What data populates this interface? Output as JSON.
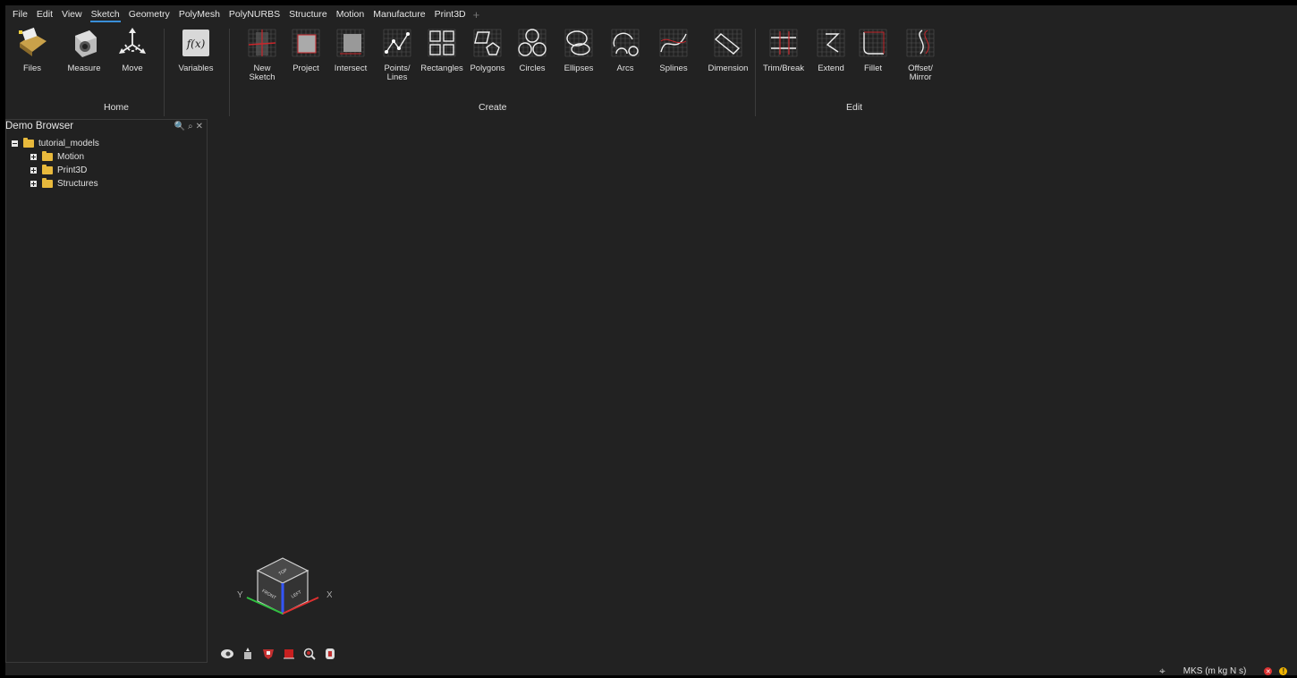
{
  "menu": [
    "File",
    "Edit",
    "View",
    "Sketch",
    "Geometry",
    "PolyMesh",
    "PolyNURBS",
    "Structure",
    "Motion",
    "Manufacture",
    "Print3D"
  ],
  "menu_active": "Sketch",
  "ribbon": {
    "home_tools": [
      "Files",
      "Measure",
      "Move"
    ],
    "variables": "Variables",
    "create_tools": [
      "New\nSketch",
      "Project",
      "Intersect",
      "Points/\nLines",
      "Rectangles",
      "Polygons",
      "Circles",
      "Ellipses",
      "Arcs",
      "Splines",
      "Dimension"
    ],
    "edit_tools": [
      "Trim/Break",
      "Extend",
      "Fillet",
      "Offset/\nMirror"
    ],
    "groups": {
      "home": "Home",
      "create": "Create",
      "edit": "Edit"
    }
  },
  "browser": {
    "title": "Demo Browser",
    "root": "tutorial_models",
    "children": [
      "Motion",
      "Print3D",
      "Structures"
    ]
  },
  "viewcube": {
    "top": "TOP",
    "front": "FRONT",
    "left": "LEFT",
    "x": "X",
    "y": "Y"
  },
  "status": {
    "units": "MKS (m kg N s)"
  },
  "colors": {
    "background": "#222222",
    "accent": "#3a8fd8",
    "grid_red": "#c8262b"
  }
}
